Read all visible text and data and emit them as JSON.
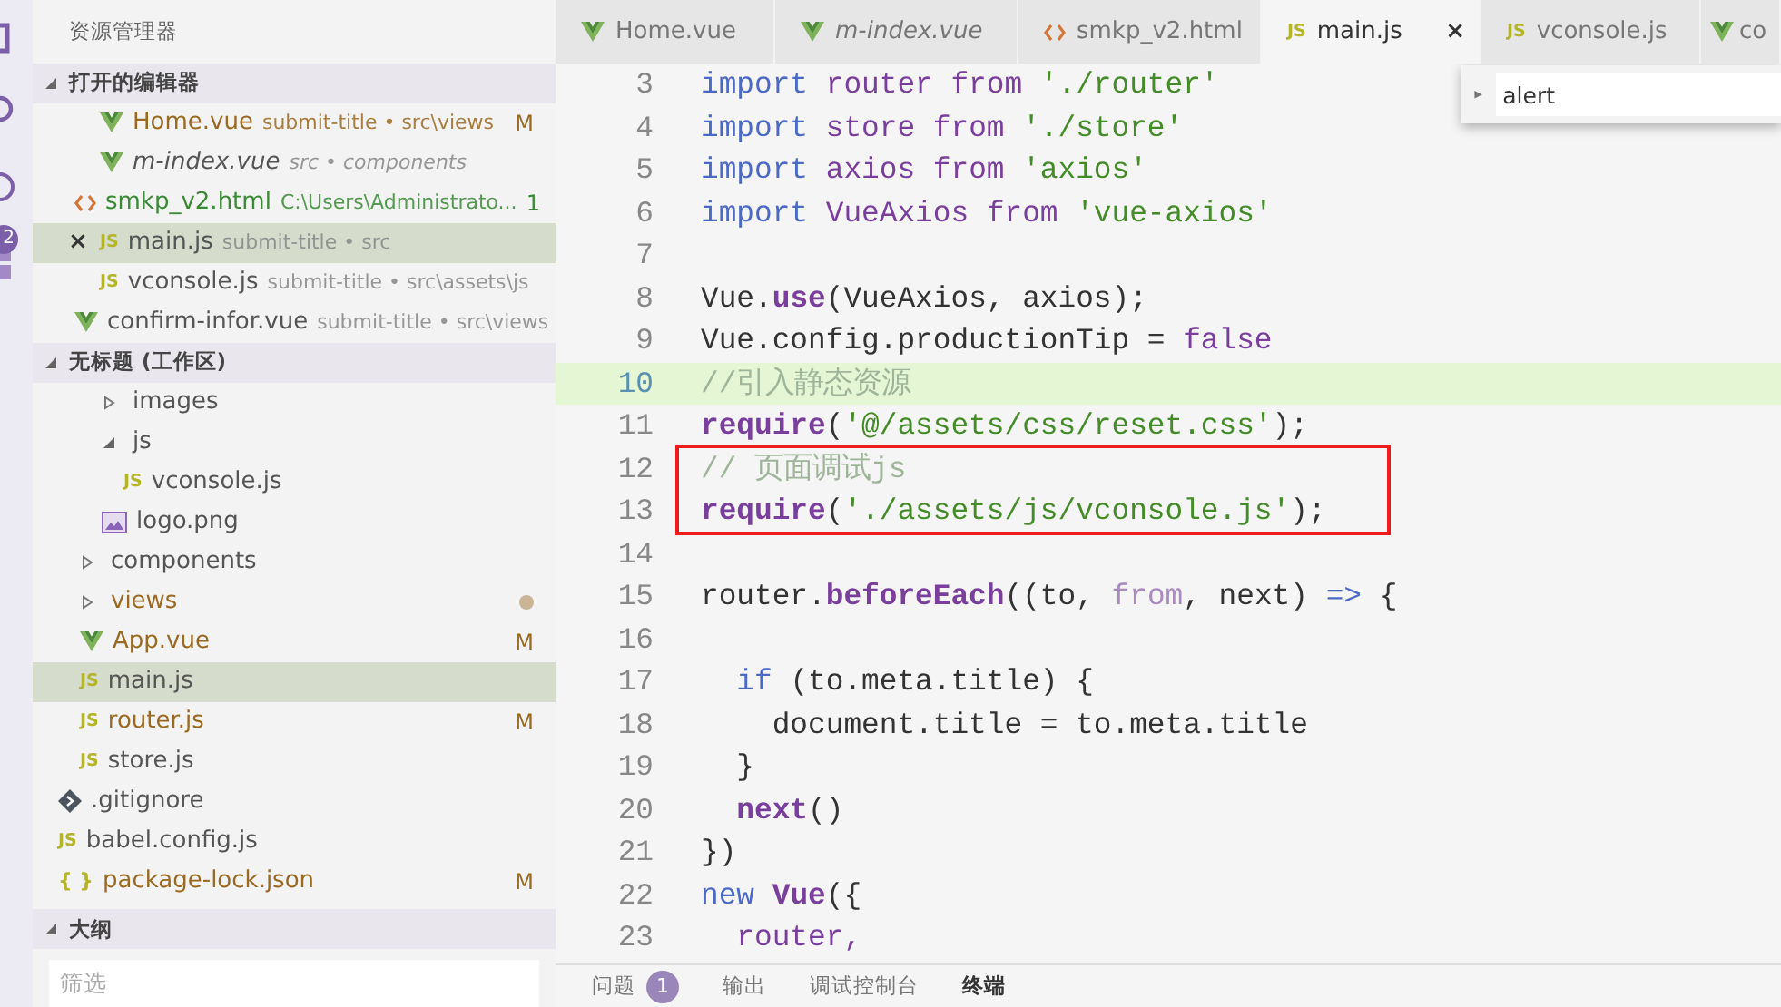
{
  "activity_bar": {
    "badge": "2"
  },
  "sidebar": {
    "title": "资源管理器",
    "open_editors": {
      "title": "打开的编辑器",
      "expanded": true,
      "items": [
        {
          "name": "Home.vue",
          "description": "submit-title • src\\views",
          "badge": "M",
          "modified": true,
          "untracked": false,
          "kind": "vue",
          "preview": false,
          "selected": false
        },
        {
          "name": "m-index.vue",
          "description": "src • components",
          "modified": false,
          "untracked": false,
          "kind": "vue",
          "preview": true,
          "selected": false
        },
        {
          "name": "smkp_v2.html",
          "description": "C:\\Users\\Administrato...",
          "badge": "1",
          "modified": false,
          "untracked": true,
          "kind": "html",
          "preview": false,
          "selected": false
        },
        {
          "name": "main.js",
          "description": "submit-title • src",
          "modified": false,
          "untracked": false,
          "kind": "js",
          "icon_glyph": "JS",
          "close": "×",
          "preview": false,
          "selected": true
        },
        {
          "name": "vconsole.js",
          "description": "submit-title • src\\assets\\js",
          "modified": false,
          "untracked": false,
          "kind": "js",
          "icon_glyph": "JS",
          "preview": false,
          "selected": false
        },
        {
          "name": "confirm-infor.vue",
          "description": "submit-title • src\\views",
          "modified": false,
          "untracked": false,
          "kind": "vue",
          "preview": false,
          "selected": false
        }
      ]
    },
    "workspace": {
      "title": "无标题 (工作区)",
      "expanded": true,
      "tree": [
        {
          "children": [
            {
              "children": [
                {
                  "name": "images",
                  "kind": "folder",
                  "expanded": false,
                  "modified": false,
                  "selected": false
                },
                {
                  "name": "js",
                  "kind": "folder",
                  "expanded": true,
                  "modified": false,
                  "selected": false,
                  "children": [
                    {
                      "name": "vconsole.js",
                      "kind": "js",
                      "icon_glyph": "JS",
                      "modified": false,
                      "selected": false
                    }
                  ]
                },
                {
                  "name": "logo.png",
                  "kind": "image",
                  "modified": false,
                  "selected": false
                }
              ]
            },
            {
              "name": "components",
              "kind": "folder",
              "expanded": false,
              "modified": false,
              "selected": false
            },
            {
              "name": "views",
              "kind": "folder",
              "expanded": false,
              "modified": true,
              "selected": false
            },
            {
              "name": "App.vue",
              "kind": "vue",
              "modified": true,
              "badge": "M",
              "selected": false
            },
            {
              "name": "main.js",
              "kind": "js",
              "icon_glyph": "JS",
              "modified": false,
              "selected": true
            },
            {
              "name": "router.js",
              "kind": "js",
              "icon_glyph": "JS",
              "modified": true,
              "badge": "M",
              "selected": false
            },
            {
              "name": "store.js",
              "kind": "js",
              "icon_glyph": "JS",
              "modified": false,
              "selected": false
            }
          ]
        },
        {
          "name": ".gitignore",
          "kind": "git",
          "modified": false,
          "selected": false
        },
        {
          "name": "babel.config.js",
          "kind": "js",
          "icon_glyph": "JS",
          "modified": false,
          "selected": false
        },
        {
          "name": "package-lock.json",
          "kind": "json",
          "icon_glyph": "{ }",
          "modified": true,
          "badge": "M",
          "selected": false
        }
      ]
    },
    "outline": {
      "title": "大纲",
      "expanded": true,
      "filter_placeholder": "筛选"
    }
  },
  "tabs": [
    {
      "label": "Home.vue",
      "kind": "vue",
      "preview": false,
      "selected": false
    },
    {
      "label": "m-index.vue",
      "kind": "vue",
      "preview": true,
      "selected": false
    },
    {
      "label": "smkp_v2.html",
      "kind": "html",
      "preview": false,
      "selected": false
    },
    {
      "label": "main.js",
      "kind": "js",
      "icon_glyph": "JS",
      "close": "×",
      "preview": false,
      "selected": true
    },
    {
      "label": "vconsole.js",
      "kind": "js",
      "icon_glyph": "JS",
      "preview": false,
      "selected": false
    },
    {
      "label": "co",
      "kind": "vue",
      "preview": false,
      "selected": false
    }
  ],
  "find_widget": {
    "twisty": "▸",
    "value": "alert"
  },
  "code": {
    "lines": [
      {
        "number": "3",
        "tokens": [
          {
            "text": "import ",
            "kind": "kw"
          },
          {
            "text": "router ",
            "kind": "var"
          },
          {
            "text": "from ",
            "kind": "ctl"
          },
          {
            "text": "'./router'",
            "kind": "str"
          }
        ]
      },
      {
        "number": "4",
        "tokens": [
          {
            "text": "import ",
            "kind": "kw"
          },
          {
            "text": "store ",
            "kind": "var"
          },
          {
            "text": "from ",
            "kind": "ctl"
          },
          {
            "text": "'./store'",
            "kind": "str"
          }
        ]
      },
      {
        "number": "5",
        "tokens": [
          {
            "text": "import ",
            "kind": "kw"
          },
          {
            "text": "axios ",
            "kind": "var"
          },
          {
            "text": "from ",
            "kind": "ctl"
          },
          {
            "text": "'axios'",
            "kind": "str"
          }
        ]
      },
      {
        "number": "6",
        "tokens": [
          {
            "text": "import ",
            "kind": "kw"
          },
          {
            "text": "VueAxios ",
            "kind": "var"
          },
          {
            "text": "from ",
            "kind": "ctl"
          },
          {
            "text": "'vue-axios'",
            "kind": "str"
          }
        ]
      },
      {
        "number": "7"
      },
      {
        "number": "8",
        "tokens": [
          {
            "text": "Vue.",
            "kind": "plain"
          },
          {
            "text": "use",
            "kind": "fn"
          },
          {
            "text": "(VueAxios, axios);",
            "kind": "plain"
          }
        ]
      },
      {
        "number": "9",
        "tokens": [
          {
            "text": "Vue.config.productionTip = ",
            "kind": "plain"
          },
          {
            "text": "false",
            "kind": "var"
          }
        ]
      },
      {
        "number": "10",
        "current": true,
        "tokens": [
          {
            "text": "//引入静态资源",
            "kind": "comment"
          }
        ]
      },
      {
        "number": "11",
        "tokens": [
          {
            "text": "require",
            "kind": "fn"
          },
          {
            "text": "(",
            "kind": "plain"
          },
          {
            "text": "'@/assets/css/reset.css'",
            "kind": "str"
          },
          {
            "text": ");",
            "kind": "plain"
          }
        ]
      },
      {
        "number": "12",
        "boxed": true,
        "tokens": [
          {
            "text": "// 页面调试js",
            "kind": "comment"
          }
        ]
      },
      {
        "number": "13",
        "boxed": true,
        "tokens": [
          {
            "text": "require",
            "kind": "fn"
          },
          {
            "text": "(",
            "kind": "plain"
          },
          {
            "text": "'./assets/js/vconsole.js'",
            "kind": "str"
          },
          {
            "text": ");",
            "kind": "plain"
          }
        ]
      },
      {
        "number": "14"
      },
      {
        "number": "15",
        "tokens": [
          {
            "text": "router.",
            "kind": "plain"
          },
          {
            "text": "beforeEach",
            "kind": "fn"
          },
          {
            "text": "((to, ",
            "kind": "plain"
          },
          {
            "text": "from",
            "kind": "param"
          },
          {
            "text": ", next) ",
            "kind": "plain"
          },
          {
            "text": "=>",
            "kind": "kw"
          },
          {
            "text": " {",
            "kind": "plain"
          }
        ]
      },
      {
        "number": "16"
      },
      {
        "number": "17",
        "tokens": [
          {
            "text": "  if",
            "kind": "kw"
          },
          {
            "text": " (to.meta.title) {",
            "kind": "plain"
          }
        ]
      },
      {
        "number": "18",
        "tokens": [
          {
            "text": "    document.title = to.meta.title",
            "kind": "plain"
          }
        ]
      },
      {
        "number": "19",
        "tokens": [
          {
            "text": "  }",
            "kind": "plain"
          }
        ]
      },
      {
        "number": "20",
        "tokens": [
          {
            "text": "  next",
            "kind": "fn"
          },
          {
            "text": "()",
            "kind": "plain"
          }
        ]
      },
      {
        "number": "21",
        "tokens": [
          {
            "text": "})",
            "kind": "plain"
          }
        ]
      },
      {
        "number": "22",
        "tokens": [
          {
            "text": "new ",
            "kind": "kw"
          },
          {
            "text": "Vue",
            "kind": "fn"
          },
          {
            "text": "({",
            "kind": "plain"
          }
        ]
      },
      {
        "number": "23",
        "tokens": [
          {
            "text": "  router,",
            "kind": "var"
          }
        ]
      }
    ]
  },
  "panel": {
    "tabs": [
      {
        "label": "问题",
        "badge": "1",
        "selected": false
      },
      {
        "label": "输出",
        "selected": false
      },
      {
        "label": "调试控制台",
        "selected": false
      },
      {
        "label": "终端",
        "selected": true
      }
    ]
  }
}
